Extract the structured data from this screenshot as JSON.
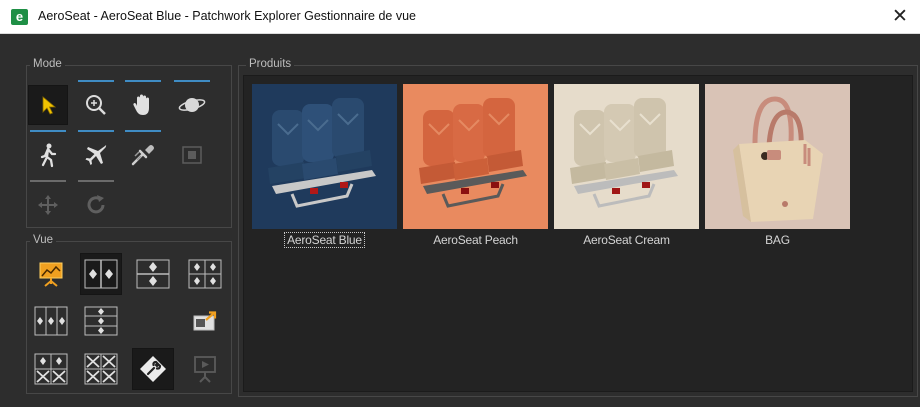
{
  "window": {
    "logo_letter": "e",
    "title": "AeroSeat - AeroSeat Blue - Patchwork Explorer Gestionnaire de vue",
    "close_glyph": "✕"
  },
  "mode_panel": {
    "label": "Mode",
    "tools": [
      {
        "name": "select-tool",
        "icon": "cursor-arrow-icon",
        "active": true
      },
      {
        "name": "zoom-tool",
        "icon": "magnifier-icon"
      },
      {
        "name": "pan-tool",
        "icon": "hand-icon"
      },
      {
        "name": "orbit-tool",
        "icon": "orbit-planet-icon"
      },
      {
        "name": "walk-tool",
        "icon": "walking-person-icon"
      },
      {
        "name": "fly-tool",
        "icon": "airplane-icon"
      },
      {
        "name": "pick-material-tool",
        "icon": "pipette-icon"
      },
      {
        "name": "fit-view-tool",
        "icon": "frame-icon",
        "disabled": true
      },
      {
        "name": "move-tool",
        "icon": "move-arrows-icon",
        "disabled": true
      },
      {
        "name": "rotate-tool",
        "icon": "rotate-icon",
        "disabled": true
      }
    ]
  },
  "view_panel": {
    "label": "Vue",
    "layouts": [
      "presentation-view-icon",
      "split-vertical-view-icon",
      "split-horizontal-view-icon",
      "quad-view-icon",
      "triple-vertical-view-icon",
      "triple-horizontal-view-icon",
      "export-view-icon",
      "quad-cross-view-icon",
      "quad-cross-alt-view-icon",
      "wrench-settings-icon",
      "presentation-disabled-icon"
    ]
  },
  "products": {
    "label": "Produits",
    "items": [
      {
        "name": "AeroSeat Blue",
        "bg": "#1f3a5c",
        "seat": "#2a4a6f",
        "pattern": "#4a6c8f",
        "selected": true
      },
      {
        "name": "AeroSeat Peach",
        "bg": "#e98a5f",
        "seat": "#d4653f",
        "pattern": "#e58a62"
      },
      {
        "name": "AeroSeat Cream",
        "bg": "#e6dccb",
        "seat": "#cfc4ad",
        "pattern": "#e8e0cf"
      },
      {
        "name": "BAG",
        "bg": "#d9c3b6"
      }
    ]
  },
  "colors": {
    "accent_blue": "#3f8cc4",
    "panel_bg": "#2d2d2d",
    "products_bg": "#232323",
    "icon_yellow": "#f2c300"
  }
}
